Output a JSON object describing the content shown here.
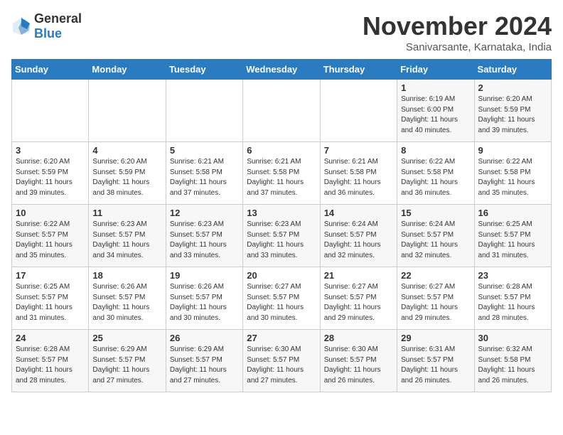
{
  "logo": {
    "text_general": "General",
    "text_blue": "Blue"
  },
  "title": "November 2024",
  "location": "Sanivarsante, Karnataka, India",
  "days_of_week": [
    "Sunday",
    "Monday",
    "Tuesday",
    "Wednesday",
    "Thursday",
    "Friday",
    "Saturday"
  ],
  "weeks": [
    [
      {
        "day": "",
        "info": ""
      },
      {
        "day": "",
        "info": ""
      },
      {
        "day": "",
        "info": ""
      },
      {
        "day": "",
        "info": ""
      },
      {
        "day": "",
        "info": ""
      },
      {
        "day": "1",
        "info": "Sunrise: 6:19 AM\nSunset: 6:00 PM\nDaylight: 11 hours\nand 40 minutes."
      },
      {
        "day": "2",
        "info": "Sunrise: 6:20 AM\nSunset: 5:59 PM\nDaylight: 11 hours\nand 39 minutes."
      }
    ],
    [
      {
        "day": "3",
        "info": "Sunrise: 6:20 AM\nSunset: 5:59 PM\nDaylight: 11 hours\nand 39 minutes."
      },
      {
        "day": "4",
        "info": "Sunrise: 6:20 AM\nSunset: 5:59 PM\nDaylight: 11 hours\nand 38 minutes."
      },
      {
        "day": "5",
        "info": "Sunrise: 6:21 AM\nSunset: 5:58 PM\nDaylight: 11 hours\nand 37 minutes."
      },
      {
        "day": "6",
        "info": "Sunrise: 6:21 AM\nSunset: 5:58 PM\nDaylight: 11 hours\nand 37 minutes."
      },
      {
        "day": "7",
        "info": "Sunrise: 6:21 AM\nSunset: 5:58 PM\nDaylight: 11 hours\nand 36 minutes."
      },
      {
        "day": "8",
        "info": "Sunrise: 6:22 AM\nSunset: 5:58 PM\nDaylight: 11 hours\nand 36 minutes."
      },
      {
        "day": "9",
        "info": "Sunrise: 6:22 AM\nSunset: 5:58 PM\nDaylight: 11 hours\nand 35 minutes."
      }
    ],
    [
      {
        "day": "10",
        "info": "Sunrise: 6:22 AM\nSunset: 5:57 PM\nDaylight: 11 hours\nand 35 minutes."
      },
      {
        "day": "11",
        "info": "Sunrise: 6:23 AM\nSunset: 5:57 PM\nDaylight: 11 hours\nand 34 minutes."
      },
      {
        "day": "12",
        "info": "Sunrise: 6:23 AM\nSunset: 5:57 PM\nDaylight: 11 hours\nand 33 minutes."
      },
      {
        "day": "13",
        "info": "Sunrise: 6:23 AM\nSunset: 5:57 PM\nDaylight: 11 hours\nand 33 minutes."
      },
      {
        "day": "14",
        "info": "Sunrise: 6:24 AM\nSunset: 5:57 PM\nDaylight: 11 hours\nand 32 minutes."
      },
      {
        "day": "15",
        "info": "Sunrise: 6:24 AM\nSunset: 5:57 PM\nDaylight: 11 hours\nand 32 minutes."
      },
      {
        "day": "16",
        "info": "Sunrise: 6:25 AM\nSunset: 5:57 PM\nDaylight: 11 hours\nand 31 minutes."
      }
    ],
    [
      {
        "day": "17",
        "info": "Sunrise: 6:25 AM\nSunset: 5:57 PM\nDaylight: 11 hours\nand 31 minutes."
      },
      {
        "day": "18",
        "info": "Sunrise: 6:26 AM\nSunset: 5:57 PM\nDaylight: 11 hours\nand 30 minutes."
      },
      {
        "day": "19",
        "info": "Sunrise: 6:26 AM\nSunset: 5:57 PM\nDaylight: 11 hours\nand 30 minutes."
      },
      {
        "day": "20",
        "info": "Sunrise: 6:27 AM\nSunset: 5:57 PM\nDaylight: 11 hours\nand 30 minutes."
      },
      {
        "day": "21",
        "info": "Sunrise: 6:27 AM\nSunset: 5:57 PM\nDaylight: 11 hours\nand 29 minutes."
      },
      {
        "day": "22",
        "info": "Sunrise: 6:27 AM\nSunset: 5:57 PM\nDaylight: 11 hours\nand 29 minutes."
      },
      {
        "day": "23",
        "info": "Sunrise: 6:28 AM\nSunset: 5:57 PM\nDaylight: 11 hours\nand 28 minutes."
      }
    ],
    [
      {
        "day": "24",
        "info": "Sunrise: 6:28 AM\nSunset: 5:57 PM\nDaylight: 11 hours\nand 28 minutes."
      },
      {
        "day": "25",
        "info": "Sunrise: 6:29 AM\nSunset: 5:57 PM\nDaylight: 11 hours\nand 27 minutes."
      },
      {
        "day": "26",
        "info": "Sunrise: 6:29 AM\nSunset: 5:57 PM\nDaylight: 11 hours\nand 27 minutes."
      },
      {
        "day": "27",
        "info": "Sunrise: 6:30 AM\nSunset: 5:57 PM\nDaylight: 11 hours\nand 27 minutes."
      },
      {
        "day": "28",
        "info": "Sunrise: 6:30 AM\nSunset: 5:57 PM\nDaylight: 11 hours\nand 26 minutes."
      },
      {
        "day": "29",
        "info": "Sunrise: 6:31 AM\nSunset: 5:57 PM\nDaylight: 11 hours\nand 26 minutes."
      },
      {
        "day": "30",
        "info": "Sunrise: 6:32 AM\nSunset: 5:58 PM\nDaylight: 11 hours\nand 26 minutes."
      }
    ]
  ]
}
